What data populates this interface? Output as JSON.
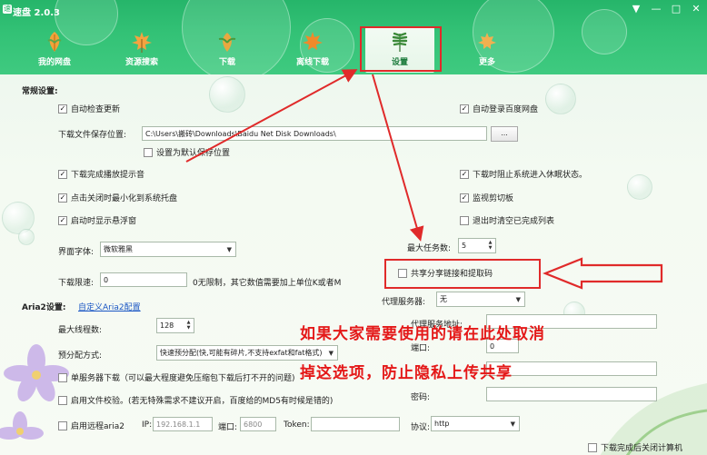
{
  "app": {
    "title": "速盘 2.0.3",
    "logo_glyph": "速"
  },
  "window_controls": {
    "menu": "▼",
    "minimize": "—",
    "maximize": "□",
    "close": "✕"
  },
  "nav": {
    "items": [
      {
        "label": "我的网盘",
        "icon": "leaf-icon",
        "color": "#f2a23a"
      },
      {
        "label": "资源搜索",
        "icon": "maple-leaf-icon",
        "color": "#f4a340"
      },
      {
        "label": "下载",
        "icon": "leaf-icon",
        "color": "#e8a840"
      },
      {
        "label": "离线下载",
        "icon": "maple-leaf-icon",
        "color": "#f08a2a"
      },
      {
        "label": "设置",
        "icon": "fern-icon",
        "color": "#3c8a3a"
      },
      {
        "label": "更多",
        "icon": "maple-leaf-icon",
        "color": "#f2b050"
      }
    ],
    "active": "设置"
  },
  "general": {
    "section_title": "常规设置:",
    "auto_update": {
      "label": "自动检查更新",
      "checked": true
    },
    "auto_login": {
      "label": "自动登录百度网盘",
      "checked": true
    },
    "save_path_label": "下载文件保存位置:",
    "save_path_value": "C:\\Users\\搬砖\\Downloads\\Baidu Net Disk Downloads\\",
    "browse_label": "...",
    "set_default": {
      "label": "设置为默认保存位置",
      "checked": false
    },
    "done_sound": {
      "label": "下载完成播放提示音",
      "checked": true
    },
    "prevent_sleep": {
      "label": "下载时阻止系统进入休眠状态。",
      "checked": true
    },
    "minimize_tray": {
      "label": "点击关闭时最小化到系统托盘",
      "checked": true
    },
    "monitor_clipboard": {
      "label": "监视剪切板",
      "checked": true
    },
    "show_float": {
      "label": "启动时显示悬浮窗",
      "checked": true
    },
    "clear_done": {
      "label": "退出时清空已完成列表",
      "checked": false
    },
    "font_label": "界面字体:",
    "font_value": "微软雅黑",
    "max_tasks_label": "最大任务数:",
    "max_tasks_value": "5",
    "share_links": {
      "label": "共享分享链接和提取码",
      "checked": false
    },
    "speed_limit_label": "下载限速:",
    "speed_limit_value": "0",
    "speed_limit_hint": "0无限制，其它数值需要加上单位K或者M"
  },
  "aria2": {
    "section_title": "Aria2设置:",
    "custom_link": "自定义Aria2配置",
    "max_threads_label": "最大线程数:",
    "max_threads_value": "128",
    "prealloc_label": "预分配方式:",
    "prealloc_value": "快速预分配(快,可能有碎片,不支持exfat和fat格式)",
    "single_server": {
      "label": "单服务器下载（可以最大程度避免压缩包下载后打不开的问题)",
      "checked": false
    },
    "file_verify": {
      "label": "启用文件校验。(若无特殊需求不建议开启，百度给的MD5有时候是错的)",
      "checked": false
    },
    "remote_aria2": {
      "label": "启用远程aria2",
      "checked": false
    },
    "ip_label": "IP:",
    "ip_value": "192.168.1.1",
    "port_label": "端口:",
    "port_value": "6800",
    "token_label": "Token:",
    "token_value": "",
    "protocol_label": "协议:",
    "protocol_value": "http"
  },
  "proxy": {
    "server_label": "代理服务器:",
    "server_value": "无",
    "address_label": "代理服务地址:",
    "port_label": "端口:",
    "port_value": "0",
    "password_label": "密码:"
  },
  "shutdown": {
    "label": "下载完成后关闭计算机",
    "checked": false
  },
  "annotation": {
    "line1": "如果大家需要使用的请在此处取消",
    "line2": "掉这选项，防止隐私上传共享",
    "color": "#e41818"
  }
}
